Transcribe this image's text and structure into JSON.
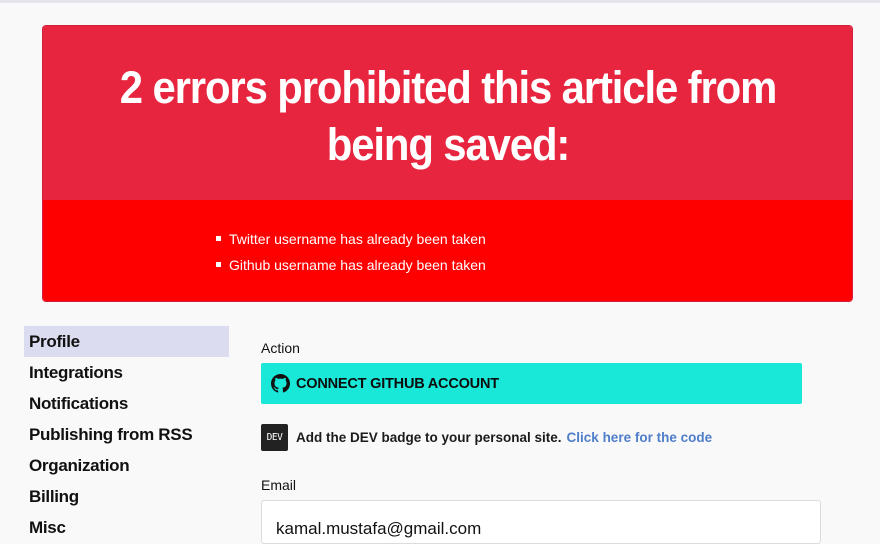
{
  "errors": {
    "title": "2 errors prohibited this article from being saved:",
    "items": [
      "Twitter username has already been taken",
      "Github username has already been taken"
    ]
  },
  "sidebar": {
    "items": [
      {
        "label": "Profile",
        "active": true
      },
      {
        "label": "Integrations",
        "active": false
      },
      {
        "label": "Notifications",
        "active": false
      },
      {
        "label": "Publishing from RSS",
        "active": false
      },
      {
        "label": "Organization",
        "active": false
      },
      {
        "label": "Billing",
        "active": false
      },
      {
        "label": "Misc",
        "active": false
      }
    ]
  },
  "main": {
    "action_label": "Action",
    "github_button_label": "CONNECT GITHUB ACCOUNT",
    "github_icon": "github-icon",
    "badge_logo_text": "DEV",
    "badge_text": "Add the DEV badge to your personal site.",
    "badge_link": "Click here for the code",
    "email_label": "Email",
    "email_value": "kamal.mustafa@gmail.com"
  },
  "colors": {
    "error_header": "#e8253e",
    "error_body": "#ff0000",
    "github_button": "#19e8d8",
    "sidebar_active": "#dcdcf0",
    "link": "#4f7ec8"
  }
}
